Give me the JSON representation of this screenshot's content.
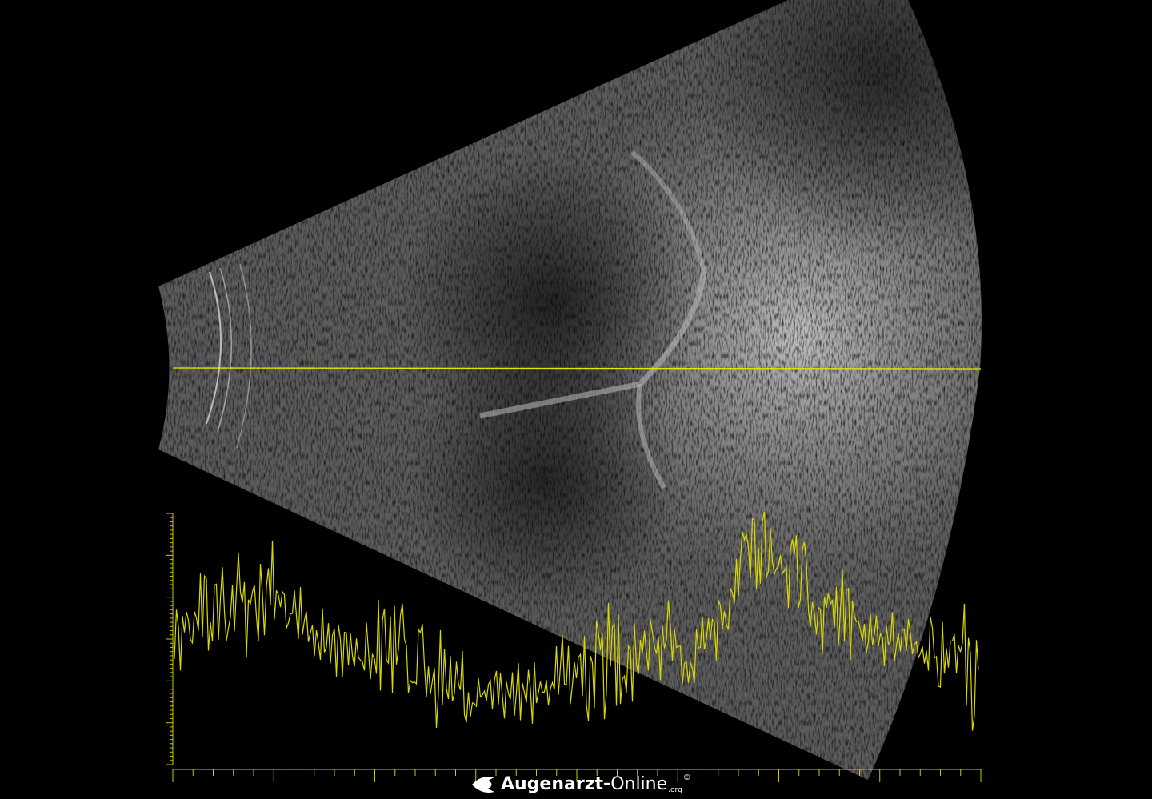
{
  "image": {
    "kind": "ocular B-scan ultrasound with A-scan trace",
    "scan_line_color": "#e6e600",
    "a_scan_color": "#d9d900"
  },
  "watermark": {
    "brand": "Augenarzt",
    "dash": "-",
    "online": "Online",
    "tld": ".org",
    "copyright": "©"
  }
}
